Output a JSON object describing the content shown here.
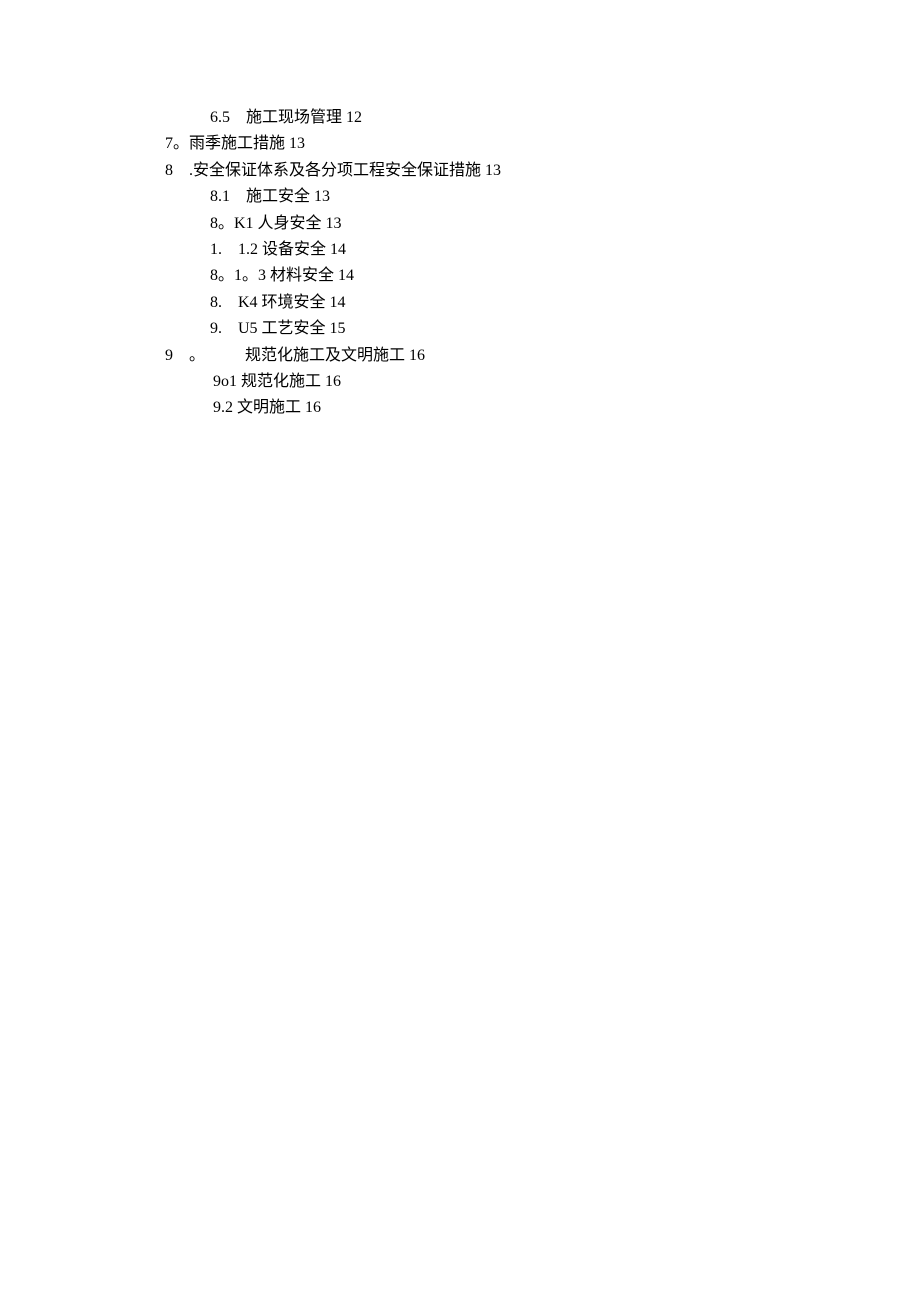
{
  "lines": [
    {
      "indent": 1,
      "text": "6.5    施工现场管理 12"
    },
    {
      "indent": 0,
      "text": "7。雨季施工措施 13"
    },
    {
      "indent": 0,
      "text": "8    .安全保证体系及各分项工程安全保证措施 13"
    },
    {
      "indent": 1,
      "text": "8.1    施工安全 13"
    },
    {
      "indent": 1,
      "text": "8。K1 人身安全 13"
    },
    {
      "indent": 1,
      "text": "1.    1.2 设备安全 14"
    },
    {
      "indent": 1,
      "text": "8。1。3 材料安全 14"
    },
    {
      "indent": 1,
      "text": "8.    K4 环境安全 14"
    },
    {
      "indent": 1,
      "text": "9.    U5 工艺安全 15"
    },
    {
      "indent": 0,
      "text": "9    。          规范化施工及文明施工 16"
    },
    {
      "indent": 2,
      "text": "9o1 规范化施工 16"
    },
    {
      "indent": 2,
      "text": "9.2 文明施工 16"
    }
  ]
}
